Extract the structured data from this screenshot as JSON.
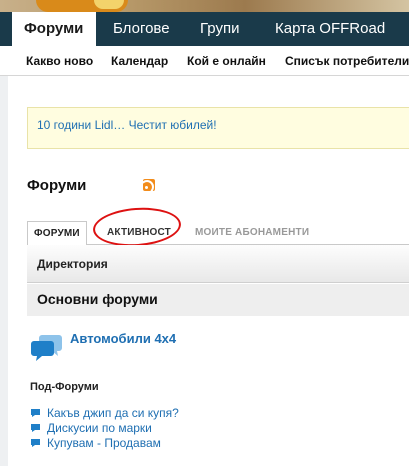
{
  "nav": {
    "tabs": [
      {
        "label": "Форуми",
        "active": true
      },
      {
        "label": "Блогове",
        "active": false
      },
      {
        "label": "Групи",
        "active": false
      },
      {
        "label": "Карта OFFRoad",
        "active": false
      }
    ]
  },
  "subnav": {
    "items": [
      "Какво ново",
      "Календар",
      "Кой е онлайн",
      "Списък потребители"
    ]
  },
  "notice": {
    "text": "10 години Lidl… Честит юбилей!"
  },
  "page": {
    "title": "Форуми",
    "rss_icon": "rss-icon"
  },
  "tabs": {
    "items": [
      "ФОРУМИ",
      "АКТИВНОСТ",
      "МОИТЕ АБОНАМЕНТИ"
    ],
    "active_index": 0
  },
  "directory": {
    "label": "Директория"
  },
  "section": {
    "title": "Основни форуми"
  },
  "forum": {
    "name": "Автомобили 4x4",
    "icon": "speech-bubbles-icon"
  },
  "subforums": {
    "title": "Под-Форуми",
    "items": [
      "Какъв джип да си купя?",
      "Дискусии по марки",
      "Купувам - Продавам"
    ]
  },
  "colors": {
    "navbar": "#1a3a4a",
    "link": "#1f6fb2",
    "notice_bg": "#fffde0",
    "annotation": "#dd1111"
  }
}
